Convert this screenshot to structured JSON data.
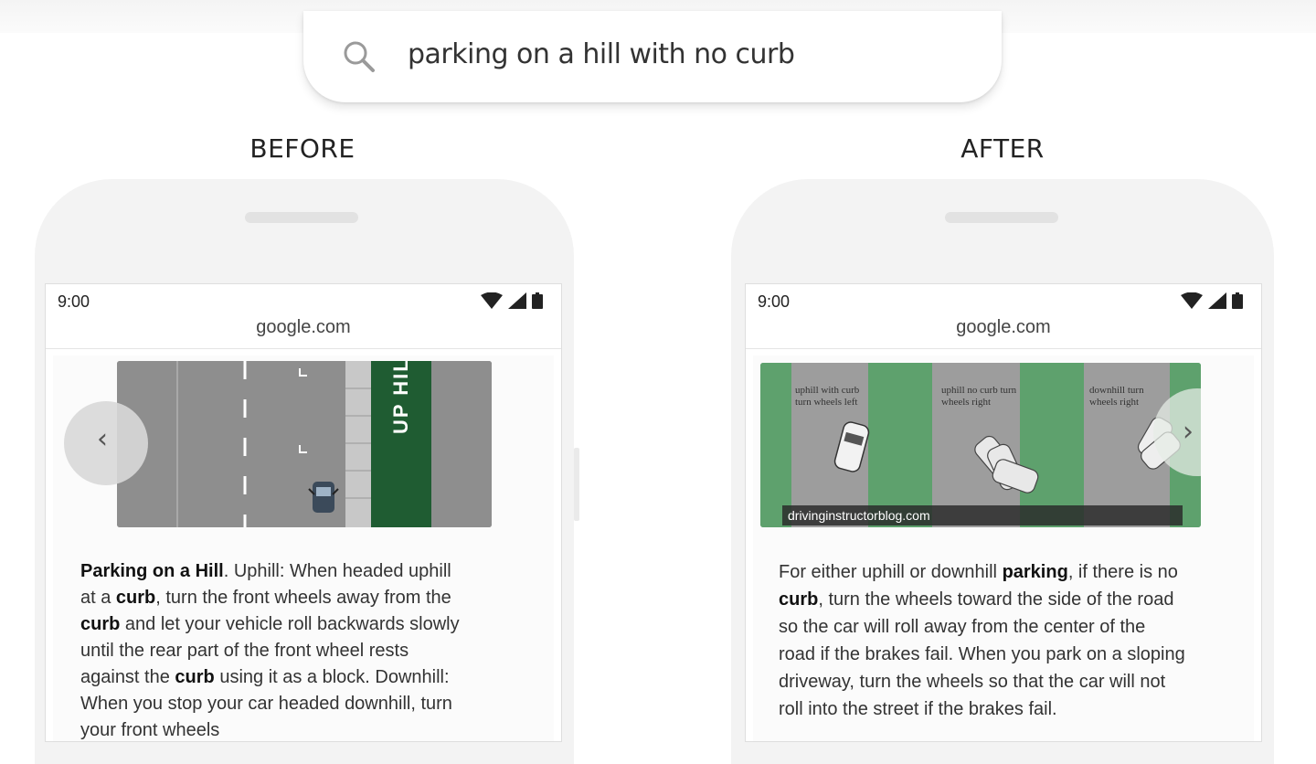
{
  "search": {
    "query": "parking on a hill with no curb"
  },
  "before": {
    "label": "BEFORE",
    "status_time": "9:00",
    "url": "google.com",
    "image_text": "UP HILL",
    "snippet": {
      "lead": "Parking on a Hill",
      "t1": ". Uphill: When headed uphill at a ",
      "w1": "curb",
      "t2": ", turn the front wheels away from the ",
      "w2": "curb",
      "t3": " and let your vehicle roll backwards slowly until the rear part of the front wheel rests against the ",
      "w3": "curb",
      "t4": " using it as a block. Downhill: When you stop your car headed downhill, turn your front wheels"
    }
  },
  "after": {
    "label": "AFTER",
    "status_time": "9:00",
    "url": "google.com",
    "image_caption": "drivinginstructorblog.com",
    "image_panels": [
      "uphill with curb turn wheels left",
      "uphill no curb turn wheels right",
      "downhill turn wheels right"
    ],
    "snippet": {
      "t1": "For either uphill or downhill ",
      "w1": "parking",
      "t2": ", if there is no ",
      "w2": "curb",
      "t3": ", turn the wheels toward the side of the road so the car will roll away from the center of the road if the brakes fail. When you park on a sloping driveway, turn the wheels so that the car will not roll into the street if the brakes fail."
    }
  },
  "icons": [
    "search-icon",
    "wifi-icon",
    "signal-icon",
    "battery-icon",
    "chevron-left-icon",
    "chevron-right-icon"
  ]
}
